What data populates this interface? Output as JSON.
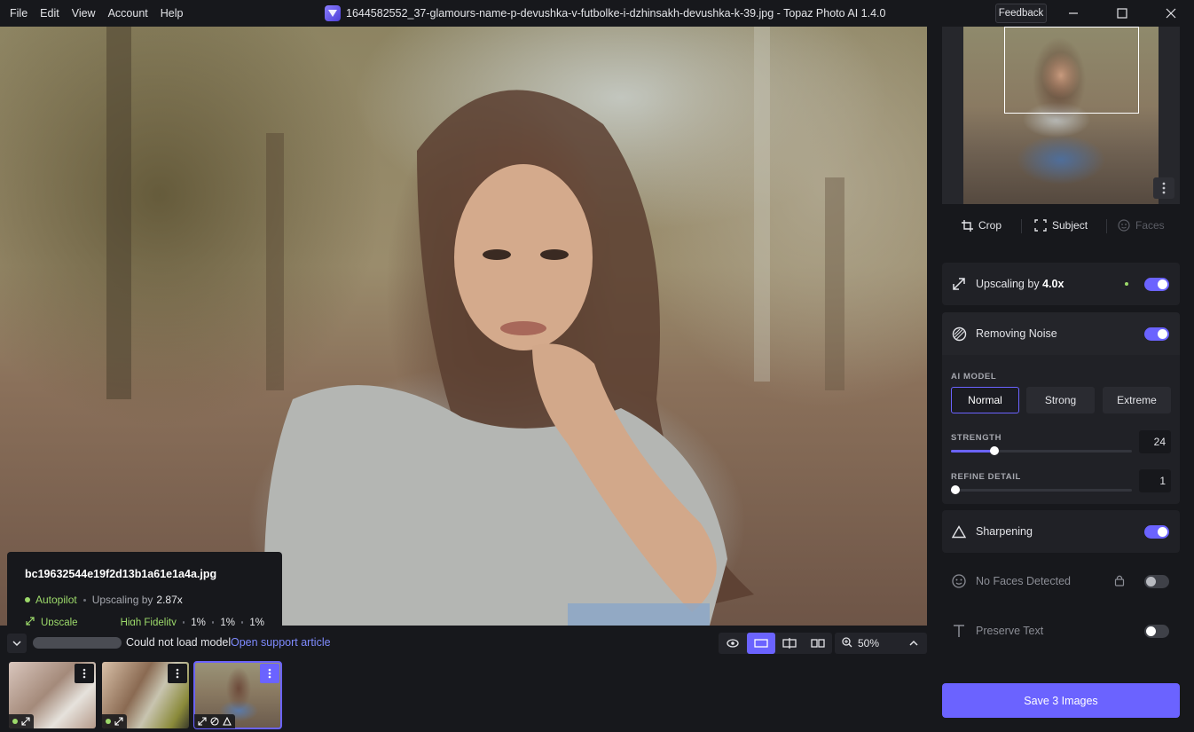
{
  "menu": [
    "File",
    "Edit",
    "View",
    "Account",
    "Help"
  ],
  "window": {
    "title": "1644582552_37-glamours-name-p-devushka-v-futbolke-i-dzhinsakh-devushka-k-39.jpg - Topaz Photo AI 1.4.0",
    "feedback_label": "Feedback"
  },
  "info_card": {
    "filename": "bc19632544e19f2d13b1a61e1a4a.jpg",
    "autopilot": "Autopilot",
    "upscaling_prefix": "Upscaling by",
    "upscaling_value": "2.87x",
    "upscale_label": "Upscale",
    "model": "High Fidelity",
    "pct1": "1%",
    "pct2": "1%",
    "pct3": "1%"
  },
  "status": {
    "message": "Could not load model",
    "link": "Open support article",
    "zoom": "50%"
  },
  "tools": {
    "crop": "Crop",
    "subject": "Subject",
    "faces": "Faces"
  },
  "filters": {
    "upscaling_prefix": "Upscaling by",
    "upscaling_value": "4.0x",
    "noise": "Removing Noise",
    "ai_model_label": "AI MODEL",
    "models": [
      "Normal",
      "Strong",
      "Extreme"
    ],
    "strength_label": "STRENGTH",
    "strength_value": "24",
    "strength_fraction": 0.24,
    "refine_label": "REFINE DETAIL",
    "refine_value": "1",
    "refine_fraction": 0.01,
    "sharpening": "Sharpening",
    "faces": "No Faces Detected",
    "preserve_text": "Preserve Text"
  },
  "save_label": "Save 3 Images",
  "colors": {
    "accent": "#6b63ff",
    "autopilot_green": "#9cd96a",
    "link": "#7f8bff"
  }
}
